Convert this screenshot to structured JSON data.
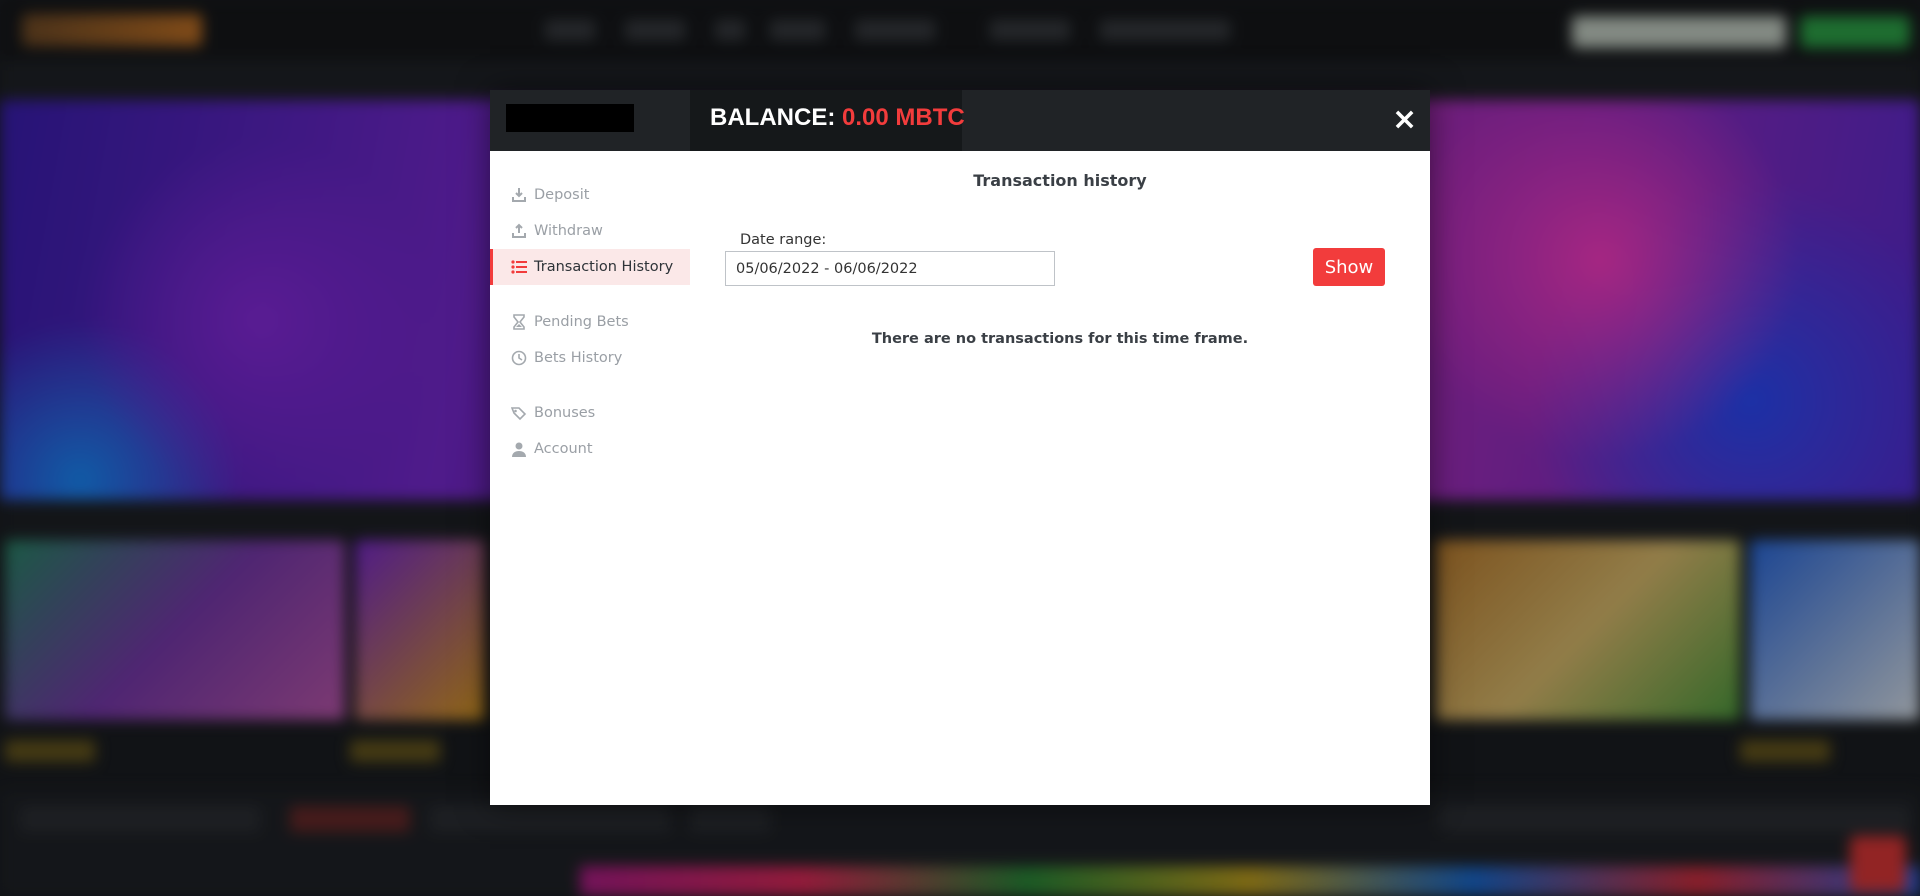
{
  "header": {
    "balance_label": "BALANCE:",
    "balance_value": "0.00 MBTC",
    "close_glyph": "×"
  },
  "sidebar": {
    "items": [
      {
        "label": "Deposit",
        "icon": "deposit-icon"
      },
      {
        "label": "Withdraw",
        "icon": "withdraw-icon"
      },
      {
        "label": "Transaction History",
        "icon": "list-icon",
        "active": true
      },
      {
        "label": "Pending Bets",
        "icon": "hourglass-icon"
      },
      {
        "label": "Bets History",
        "icon": "clock-icon"
      },
      {
        "label": "Bonuses",
        "icon": "bonus-tag-icon"
      },
      {
        "label": "Account",
        "icon": "user-icon"
      }
    ]
  },
  "main": {
    "title": "Transaction history",
    "date_range_label": "Date range:",
    "date_range_value": "05/06/2022 - 06/06/2022",
    "show_label": "Show",
    "empty_message": "There are no transactions for this time frame."
  },
  "colors": {
    "accent": "#f23c3c",
    "header_bg": "#202326",
    "active_item_bg": "#fbe8e8"
  }
}
